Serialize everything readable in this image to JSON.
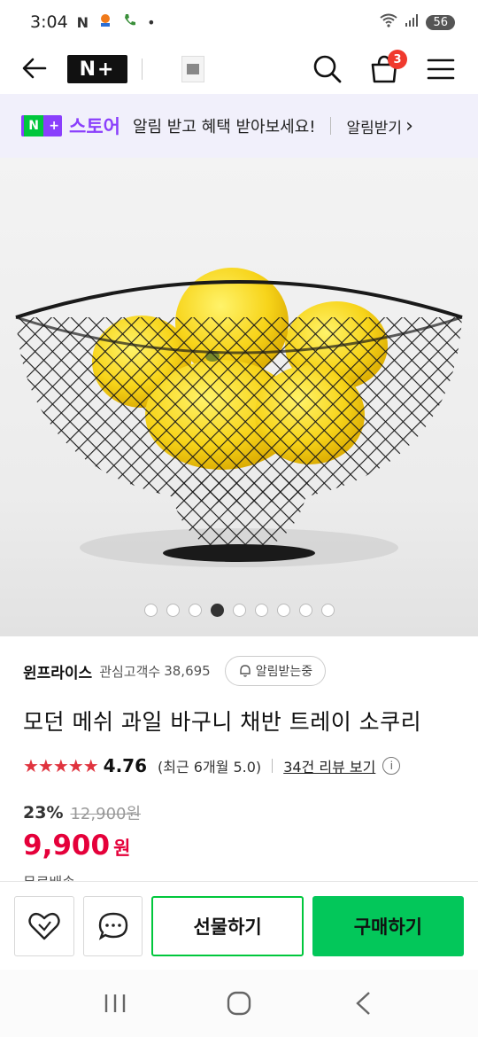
{
  "status_bar": {
    "time": "3:04",
    "notif_icons": [
      "naver-n-icon",
      "location-icon",
      "phone-icon",
      "dot-icon"
    ],
    "notif_n": "N",
    "notif_dot": "•",
    "battery": "56"
  },
  "header": {
    "logo_text": "N+",
    "cart_count": "3"
  },
  "promo": {
    "badge_n": "N",
    "badge_plus": "+",
    "store_label": "스토어",
    "message": "알림 받고 혜택 받아보세요!",
    "action_label": "알림받기",
    "action_chevron": "›"
  },
  "gallery": {
    "page_count": 9,
    "active_index": 3
  },
  "seller": {
    "name": "윈프라이스",
    "follower_label": "관심고객수",
    "follower_count": "38,695",
    "alert_label": "알림받는중"
  },
  "product": {
    "title": "모던 메쉬 과일 바구니 채반 트레이 소쿠리",
    "stars": "★★★★★",
    "rating": "4.76",
    "recent_rating": "(최근 6개월 5.0)",
    "review_link": "34건 리뷰 보기",
    "info_glyph": "i",
    "discount_rate": "23%",
    "original_price": "12,900원",
    "price": "9,900",
    "price_unit": "원",
    "shipping": "무료배송"
  },
  "actions": {
    "gift_label": "선물하기",
    "buy_label": "구매하기"
  },
  "colors": {
    "naver_green": "#03c75a",
    "price_red": "#e5003a",
    "star_red": "#e0333e",
    "promo_purple": "#8a3ffc",
    "banner_bg": "#f1f0fb"
  }
}
